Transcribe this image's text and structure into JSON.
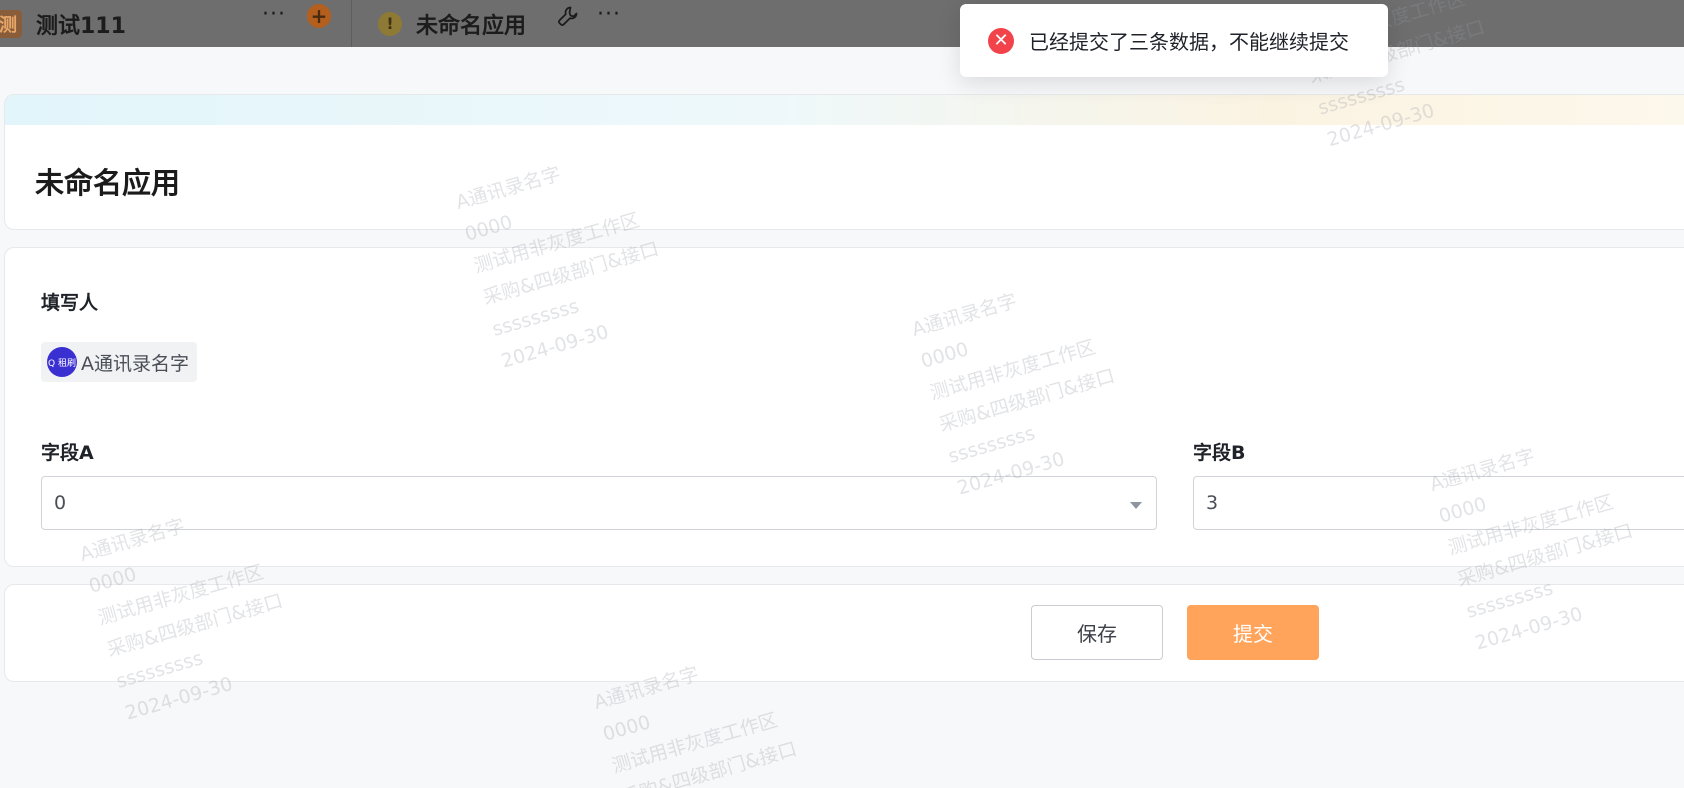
{
  "topbar": {
    "tab1": {
      "logo": "测",
      "title": "测试111",
      "more_icon": "more-dots-icon",
      "add_icon": "plus-circle-icon"
    },
    "tab2": {
      "warn_icon": "warning-circle-icon",
      "title": "未命名应用",
      "tool_icon": "wrench-icon",
      "more_icon": "more-dots-icon"
    }
  },
  "toast": {
    "icon": "error-circle-icon",
    "message": "已经提交了三条数据，不能继续提交"
  },
  "header": {
    "title": "未命名应用"
  },
  "form": {
    "filler_label": "填写人",
    "filler": {
      "avatar_text": "Q 租刷",
      "name": "A通讯录名字"
    },
    "field_a": {
      "label": "字段A",
      "value": "0"
    },
    "field_b": {
      "label": "字段B",
      "value": "3"
    }
  },
  "actions": {
    "save_label": "保存",
    "submit_label": "提交"
  },
  "watermark": {
    "lines": [
      "A通讯录名字",
      "0000",
      "测试用非灰度工作区",
      "采购&四级部门&接口",
      "sssssssss",
      "2024-09-30"
    ]
  },
  "colors": {
    "accent": "#ffa45a",
    "error": "#f2434b",
    "topbar": "#6e6e6e"
  }
}
